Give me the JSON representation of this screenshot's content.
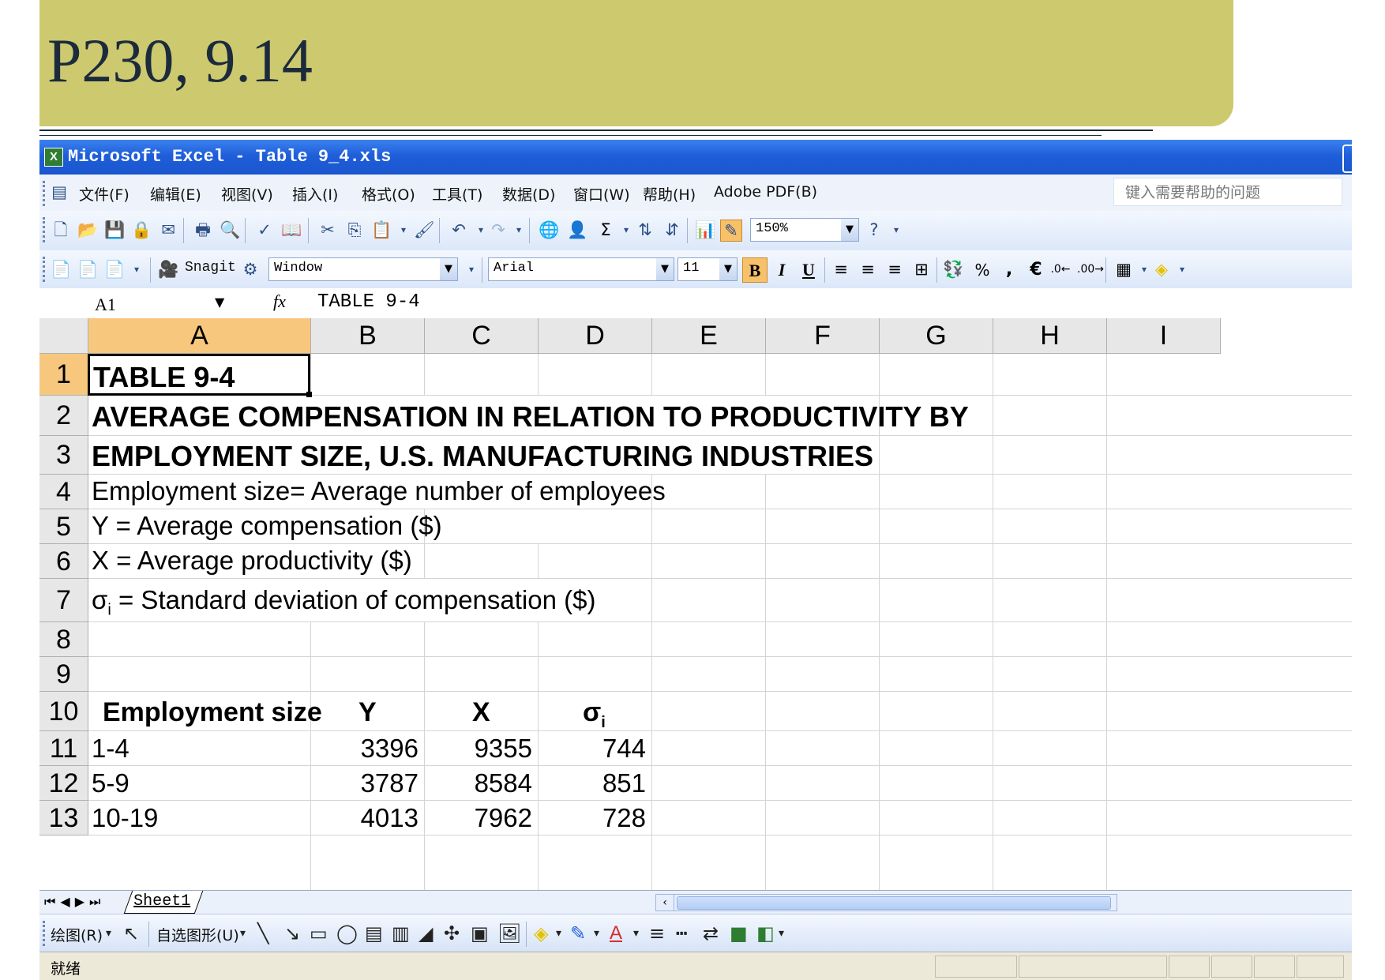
{
  "slide": {
    "title": "P230, 9.14"
  },
  "window": {
    "title": "Microsoft Excel - Table 9_4.xls",
    "app_icon": "excel-icon"
  },
  "menu": {
    "items": [
      "文件(F)",
      "编辑(E)",
      "视图(V)",
      "插入(I)",
      "格式(O)",
      "工具(T)",
      "数据(D)",
      "窗口(W)",
      "帮助(H)",
      "Adobe PDF(B)"
    ],
    "help_placeholder": "键入需要帮助的问题"
  },
  "toolbar": {
    "zoom": "150%",
    "font_name": "Arial",
    "font_size": "11",
    "snagit_label": "Snagit",
    "snagit_combo": "Window",
    "bold": "B",
    "italic": "I",
    "underline": "U",
    "percent": "%",
    "comma": ",",
    "euro": "€"
  },
  "formula_bar": {
    "name_box": "A1",
    "fx": "fx",
    "content": "TABLE 9-4"
  },
  "sheet": {
    "columns": [
      "A",
      "B",
      "C",
      "D",
      "E",
      "F",
      "G",
      "H",
      "I"
    ],
    "selected_column": "A",
    "rows": [
      "1",
      "2",
      "3",
      "4",
      "5",
      "6",
      "7",
      "8",
      "9",
      "10",
      "11",
      "12",
      "13"
    ],
    "selected_row": "1",
    "cells": {
      "a1": "TABLE 9-4",
      "a2": "AVERAGE COMPENSATION IN RELATION TO PRODUCTIVITY BY",
      "a3": "EMPLOYMENT SIZE, U.S. MANUFACTURING INDUSTRIES",
      "a4": "Employment size= Average number of employees",
      "a5": "Y = Average compensation ($)",
      "a6": "X = Average productivity ($)",
      "a7_symbol": "σ",
      "a7_sub": "i",
      "a7_text": " = Standard deviation of compensation ($)"
    },
    "table": {
      "headers": {
        "size": "Employment size",
        "y": "Y",
        "x": "X",
        "sigma": "σ",
        "sigma_sub": "i"
      },
      "rows": [
        {
          "size": "1-4",
          "y": "3396",
          "x": "9355",
          "sigma": "744"
        },
        {
          "size": "5-9",
          "y": "3787",
          "x": "8584",
          "sigma": "851"
        },
        {
          "size": "10-19",
          "y": "4013",
          "x": "7962",
          "sigma": "728"
        }
      ]
    }
  },
  "sheet_tabs": {
    "tab": "Sheet1"
  },
  "draw_toolbar": {
    "draw_menu": "绘图(R)",
    "autoshapes_menu": "自选图形(U)"
  },
  "status": {
    "text": "就绪"
  }
}
